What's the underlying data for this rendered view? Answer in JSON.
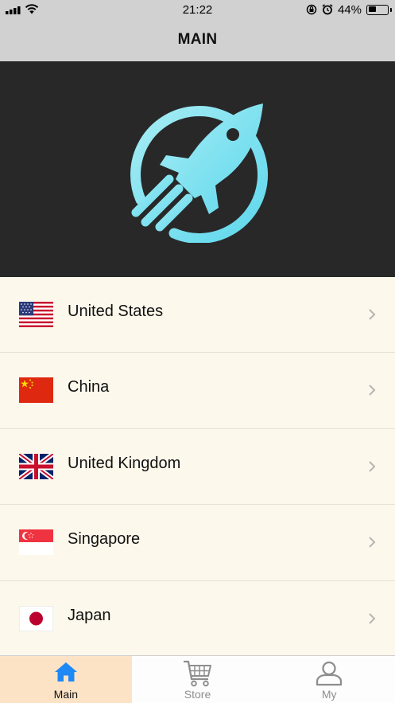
{
  "status": {
    "time": "21:22",
    "battery_text": "44%",
    "battery_level": 0.44
  },
  "header": {
    "title": "MAIN"
  },
  "hero": {
    "logo_icon": "rocket-icon",
    "logo_color": "#7fe0ef"
  },
  "countries": [
    {
      "name": "United States",
      "flag": "flag-us-icon"
    },
    {
      "name": "China",
      "flag": "flag-cn-icon"
    },
    {
      "name": "United Kingdom",
      "flag": "flag-uk-icon"
    },
    {
      "name": "Singapore",
      "flag": "flag-sg-icon"
    },
    {
      "name": "Japan",
      "flag": "flag-jp-icon"
    }
  ],
  "tabs": [
    {
      "label": "Main",
      "icon": "home-icon",
      "active": true
    },
    {
      "label": "Store",
      "icon": "cart-icon",
      "active": false
    },
    {
      "label": "My",
      "icon": "user-icon",
      "active": false
    }
  ],
  "colors": {
    "accent": "#1e88f5",
    "active_tab_bg": "#fde3c6",
    "list_bg": "#fdf8ec",
    "hero_bg": "#282828"
  }
}
